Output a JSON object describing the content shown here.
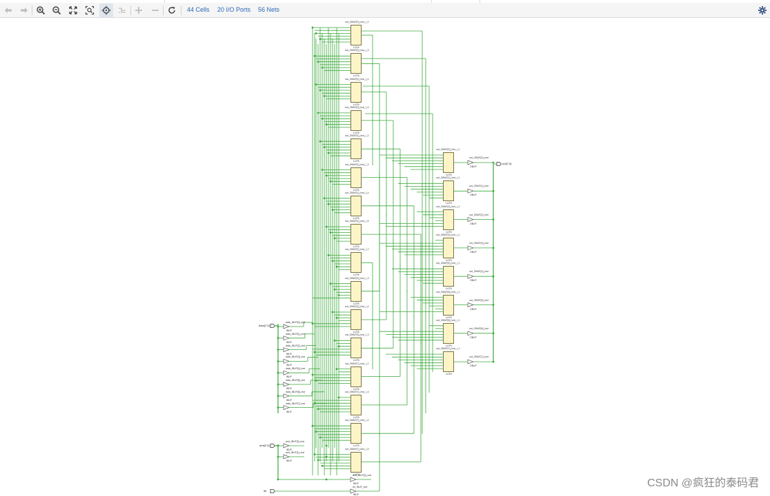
{
  "toolbar": {
    "buttons": [
      {
        "name": "back-button",
        "icon": "arrow-left-icon",
        "enabled": false
      },
      {
        "name": "forward-button",
        "icon": "arrow-right-icon",
        "enabled": false
      },
      {
        "name": "zoom-in-button",
        "icon": "zoom-in-icon",
        "enabled": true
      },
      {
        "name": "zoom-out-button",
        "icon": "zoom-out-icon",
        "enabled": true
      },
      {
        "name": "zoom-fit-button",
        "icon": "fit-icon",
        "enabled": true
      },
      {
        "name": "zoom-area-button",
        "icon": "zoom-area-icon",
        "enabled": true
      },
      {
        "name": "select-mode-button",
        "icon": "crosshair-icon",
        "enabled": true,
        "active": true
      },
      {
        "name": "route-button",
        "icon": "route-icon",
        "enabled": false
      },
      {
        "name": "expand-button",
        "icon": "plus-icon",
        "enabled": false
      },
      {
        "name": "collapse-button",
        "icon": "minus-icon",
        "enabled": false
      },
      {
        "name": "refresh-button",
        "icon": "refresh-icon",
        "enabled": true
      }
    ],
    "cells_label": "44 Cells",
    "ports_label": "20 I/O Ports",
    "nets_label": "56 Nets",
    "settings_icon": "gear-icon"
  },
  "schematic": {
    "colors": {
      "wire": "#3aa83a",
      "cell_fill": "#fdf5c8",
      "cell_border": "#7a7040",
      "link": "#2a66b8"
    },
    "lut_column": [
      {
        "name": "out_OBUF[0]_inst_i_2",
        "type": "LUT6"
      },
      {
        "name": "out_OBUF[0]_inst_i_3",
        "type": "LUT6"
      },
      {
        "name": "out_OBUF[0]_inst_i_4",
        "type": "LUT6"
      },
      {
        "name": "out_OBUF[0]_inst_i_5",
        "type": "LUT6"
      },
      {
        "name": "out_OBUF[1]_inst_i_2",
        "type": "LUT6"
      },
      {
        "name": "out_OBUF[1]_inst_i_3",
        "type": "LUT6"
      },
      {
        "name": "out_OBUF[1]_inst_i_4",
        "type": "LUT6"
      },
      {
        "name": "out_OBUF[1]_inst_i_5",
        "type": "LUT6"
      },
      {
        "name": "out_OBUF[2]_inst_i_2",
        "type": "LUT6"
      },
      {
        "name": "out_OBUF[2]_inst_i_3",
        "type": "LUT6"
      },
      {
        "name": "out_OBUF[2]_inst_i_4",
        "type": "LUT6"
      },
      {
        "name": "out_OBUF[3]_inst_i_3",
        "type": "LUT6"
      },
      {
        "name": "out_OBUF[7]_inst_i_2",
        "type": "LUT6"
      },
      {
        "name": "out_OBUF[7]_inst_i_3",
        "type": "LUT6"
      },
      {
        "name": "out_OBUF[7]_inst_i_4",
        "type": "LUT6"
      },
      {
        "name": "out_OBUF[7]_inst_i_5",
        "type": "LUT6"
      }
    ],
    "mux_column": [
      {
        "name": "out_OBUF[0]_inst_i_1",
        "type": "LUT6"
      },
      {
        "name": "out_OBUF[1]_inst_i_1",
        "type": "LUT6"
      },
      {
        "name": "out_OBUF[2]_inst_i_1",
        "type": "LUT6"
      },
      {
        "name": "out_OBUF[3]_inst_i_1",
        "type": "LUT6"
      },
      {
        "name": "out_OBUF[4]_inst_i_1",
        "type": "LUT6"
      },
      {
        "name": "out_OBUF[5]_inst_i_1",
        "type": "LUT6"
      },
      {
        "name": "out_OBUF[6]_inst_i_1",
        "type": "LUT6"
      },
      {
        "name": "out_OBUF[7]_inst_i_1",
        "type": "LUT6"
      }
    ],
    "obufs": [
      {
        "name": "out_OBUF[0]_inst",
        "type": "OBUF"
      },
      {
        "name": "out_OBUF[1]_inst",
        "type": "OBUF"
      },
      {
        "name": "out_OBUF[2]_inst",
        "type": "OBUF"
      },
      {
        "name": "out_OBUF[3]_inst",
        "type": "OBUF"
      },
      {
        "name": "out_OBUF[4]_inst",
        "type": "OBUF"
      },
      {
        "name": "out_OBUF[5]_inst",
        "type": "OBUF"
      },
      {
        "name": "out_OBUF[6]_inst",
        "type": "OBUF"
      },
      {
        "name": "out_OBUF[7]_inst",
        "type": "OBUF"
      }
    ],
    "ibufs_data": [
      {
        "name": "data_IBUF[0]_inst",
        "type": "IBUF"
      },
      {
        "name": "data_IBUF[1]_inst",
        "type": "IBUF"
      },
      {
        "name": "data_IBUF[2]_inst",
        "type": "IBUF"
      },
      {
        "name": "data_IBUF[3]_inst",
        "type": "IBUF"
      },
      {
        "name": "data_IBUF[4]_inst",
        "type": "IBUF"
      },
      {
        "name": "data_IBUF[5]_inst",
        "type": "IBUF"
      },
      {
        "name": "data_IBUF[6]_inst",
        "type": "IBUF"
      },
      {
        "name": "data_IBUF[7]_inst",
        "type": "IBUF"
      }
    ],
    "ibufs_amt": [
      {
        "name": "amt_IBUF[0]_inst",
        "type": "IBUF"
      },
      {
        "name": "amt_IBUF[1]_inst",
        "type": "IBUF"
      },
      {
        "name": "amt_IBUF[2]_inst",
        "type": "IBUF"
      }
    ],
    "ibuf_dir": {
      "name": "dir_IBUF_inst",
      "type": "IBUF"
    },
    "ports": {
      "data": "data[7:0]",
      "amt": "amt[2:0]",
      "dir": "dir",
      "out": "out[7:0]"
    }
  },
  "watermark": "CSDN @疯狂的泰码君"
}
